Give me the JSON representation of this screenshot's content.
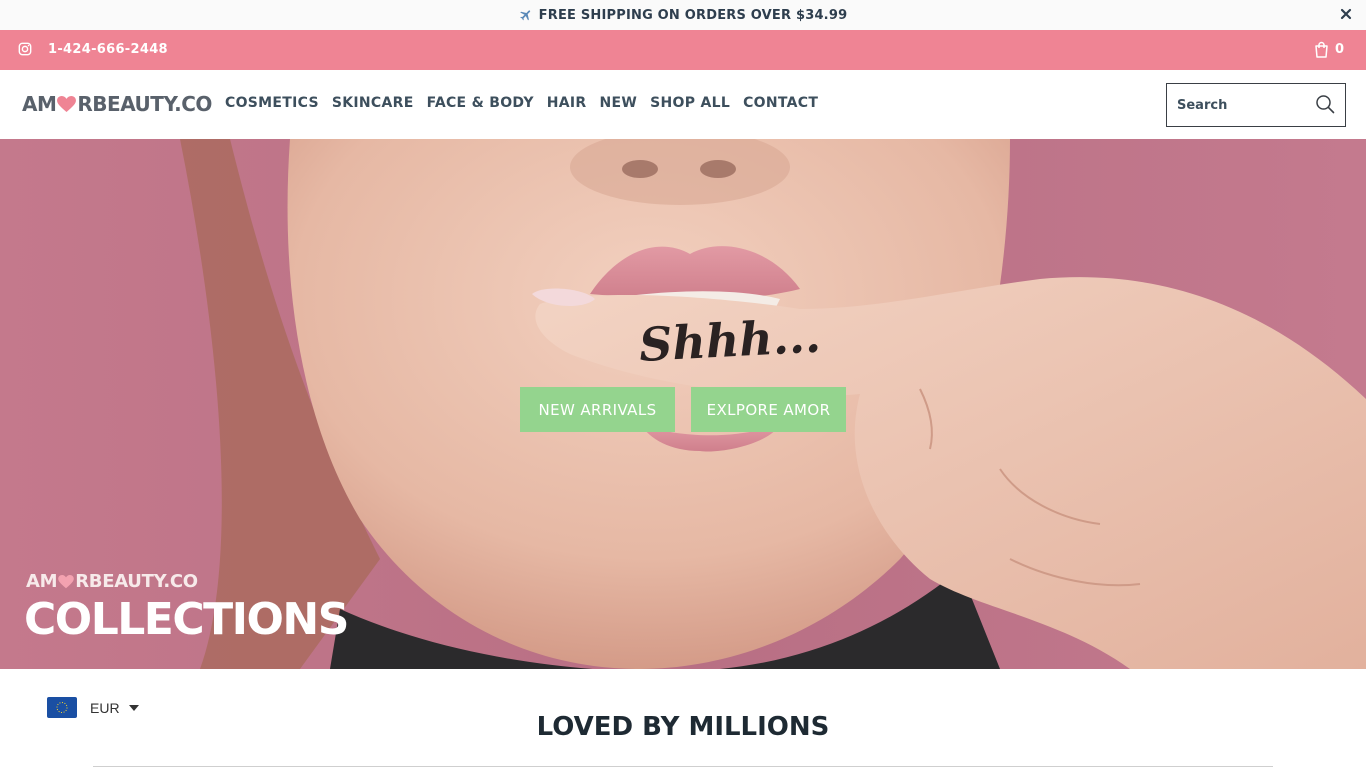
{
  "announcement": {
    "icon": "airplane-icon",
    "text": "FREE SHIPPING ON ORDERS OVER $34.99",
    "close_icon": "close-icon"
  },
  "utility_bar": {
    "background": "#ef8494",
    "social_icon": "instagram-icon",
    "phone": "1-424-666-2448",
    "cart_icon": "shopping-bag-icon",
    "cart_count": "0"
  },
  "header": {
    "logo": {
      "part1": "AM",
      "heart_icon": "heart-icon",
      "part2": "RBEAUTY.CO"
    },
    "nav": [
      {
        "label": "COSMETICS"
      },
      {
        "label": "SKINCARE"
      },
      {
        "label": "FACE & BODY"
      },
      {
        "label": "HAIR"
      },
      {
        "label": "NEW"
      },
      {
        "label": "SHOP ALL"
      },
      {
        "label": "CONTACT"
      }
    ],
    "search": {
      "placeholder": "Search",
      "value": "",
      "icon": "search-icon"
    }
  },
  "hero": {
    "buttons": [
      {
        "label": "NEW ARRIVALS"
      },
      {
        "label": "EXLPORE AMOR"
      }
    ],
    "finger_text": "Shhh...",
    "brand": {
      "part1": "AM",
      "heart_icon": "heart-icon",
      "part2": "RBEAUTY.CO"
    },
    "collections": "COLLECTIONS",
    "button_color": "#94d48e"
  },
  "currency": {
    "flag_icon": "eu-flag-icon",
    "selected": "EUR",
    "caret_icon": "caret-down-icon"
  },
  "section": {
    "title": "LOVED BY MILLIONS"
  }
}
